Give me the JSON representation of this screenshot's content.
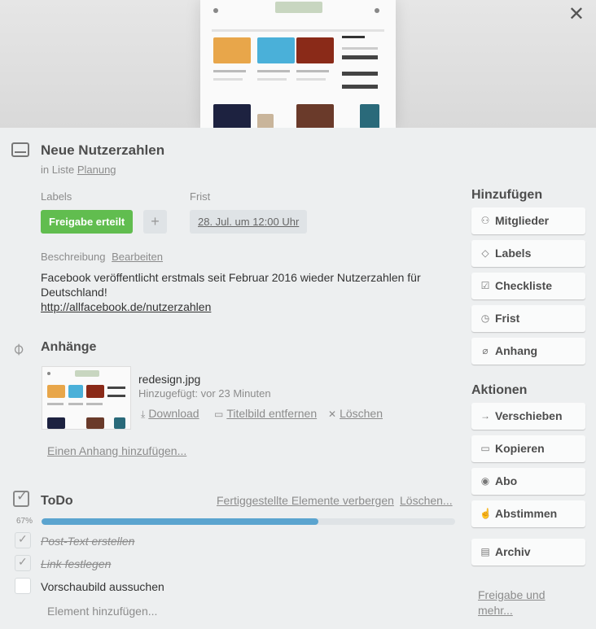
{
  "card": {
    "title": "Neue Nutzerzahlen",
    "in_list_prefix": "in Liste",
    "list_name": "Planung"
  },
  "labels": {
    "heading": "Labels",
    "items": [
      {
        "text": "Freigabe erteilt",
        "color": "#61bd4f"
      }
    ],
    "add_symbol": "+"
  },
  "due": {
    "heading": "Frist",
    "value": "28. Jul. um 12:00 Uhr"
  },
  "description": {
    "heading": "Beschreibung",
    "edit_label": "Bearbeiten",
    "text": "Facebook veröffentlicht erstmals seit Februar 2016 wieder Nutzerzahlen für Deutschland!",
    "link": "http://allfacebook.de/nutzerzahlen"
  },
  "attachments": {
    "heading": "Anhänge",
    "items": [
      {
        "name": "redesign.jpg",
        "meta": "Hinzugefügt: vor 23 Minuten",
        "actions": {
          "download": "Download",
          "remove_cover": "Titelbild entfernen",
          "delete": "Löschen"
        }
      }
    ],
    "add_label": "Einen Anhang hinzufügen..."
  },
  "checklist": {
    "heading": "ToDo",
    "hide_completed": "Fertiggestellte Elemente verbergen",
    "delete": "Löschen...",
    "progress_label": "67%",
    "progress": 0.67,
    "items": [
      {
        "text": "Post-Text erstellen",
        "done": true
      },
      {
        "text": "Link festlegen",
        "done": true
      },
      {
        "text": "Vorschaubild aussuchen",
        "done": false
      }
    ],
    "add_item": "Element hinzufügen..."
  },
  "sidebar": {
    "add_heading": "Hinzufügen",
    "add_buttons": [
      {
        "label": "Mitglieder",
        "icon": "person-icon"
      },
      {
        "label": "Labels",
        "icon": "tag-icon"
      },
      {
        "label": "Checkliste",
        "icon": "checkbox-icon"
      },
      {
        "label": "Frist",
        "icon": "clock-icon"
      },
      {
        "label": "Anhang",
        "icon": "paperclip-icon"
      }
    ],
    "actions_heading": "Aktionen",
    "action_buttons": [
      {
        "label": "Verschieben",
        "icon": "arrow-right-icon"
      },
      {
        "label": "Kopieren",
        "icon": "card-icon"
      },
      {
        "label": "Abo",
        "icon": "eye-icon"
      },
      {
        "label": "Abstimmen",
        "icon": "thumbs-up-icon"
      },
      {
        "label": "Archiv",
        "icon": "archive-icon"
      }
    ],
    "share_label": "Freigabe und mehr..."
  },
  "close_symbol": "✕"
}
